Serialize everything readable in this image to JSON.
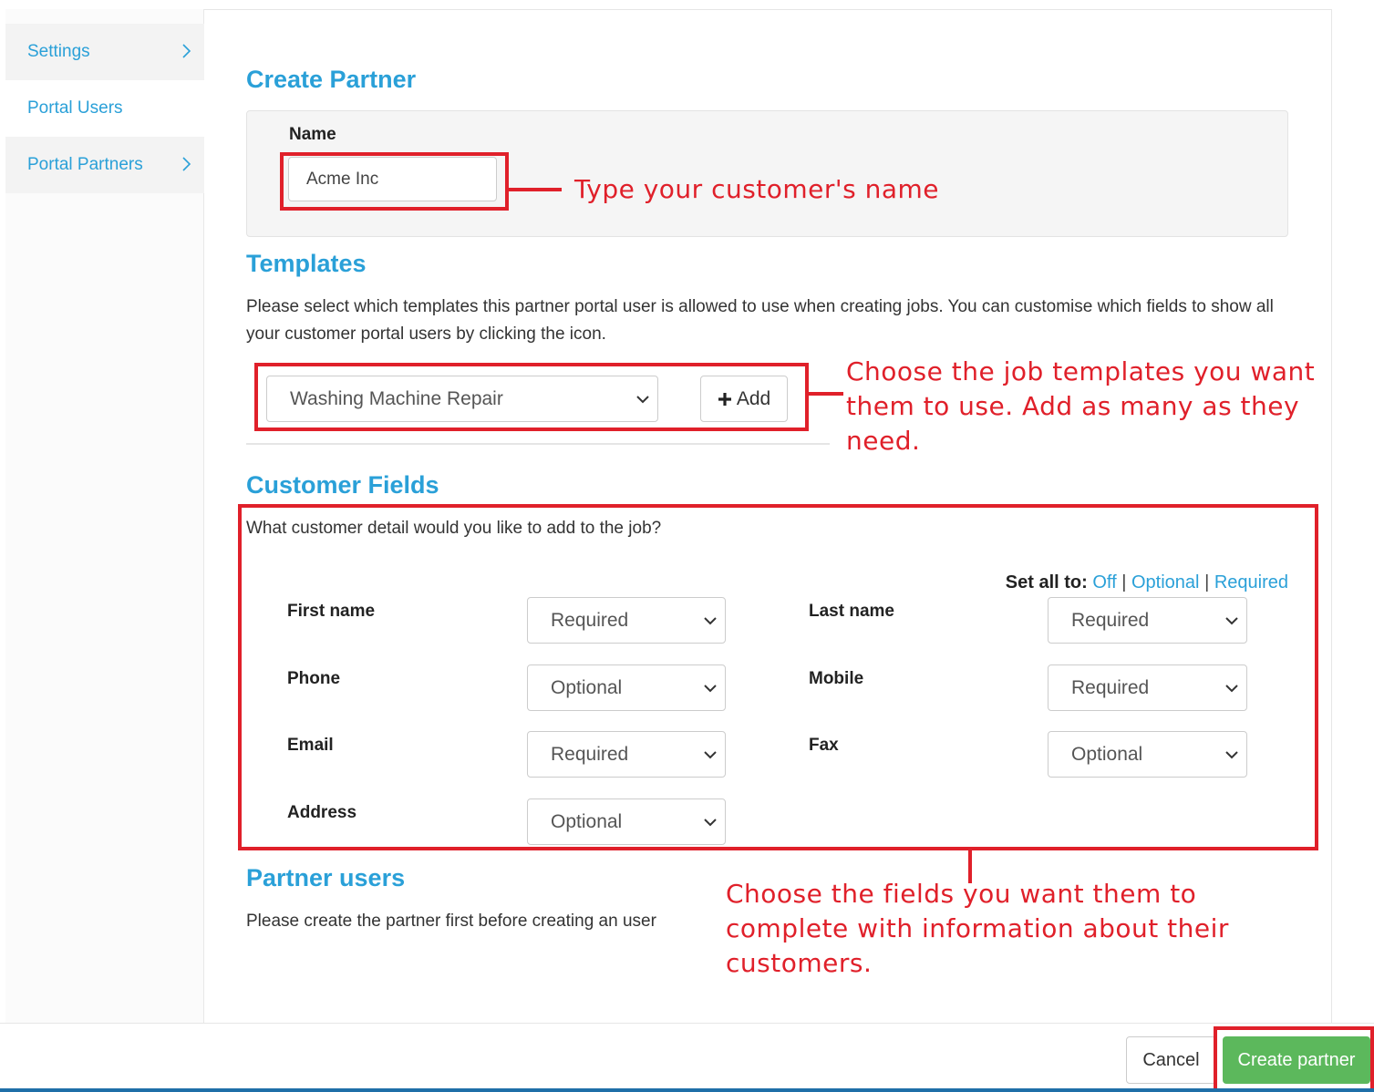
{
  "sidebar": {
    "items": [
      {
        "label": "Settings"
      },
      {
        "label": "Portal Users"
      },
      {
        "label": "Portal Partners"
      }
    ]
  },
  "create_partner": {
    "title": "Create Partner",
    "name_label": "Name",
    "name_value": "Acme Inc"
  },
  "templates": {
    "title": "Templates",
    "description": "Please select which templates this partner portal user is allowed to use when creating jobs. You can customise which fields to show all your customer portal users by clicking the icon.",
    "selected": "Washing Machine Repair",
    "add_label": "Add"
  },
  "customer_fields": {
    "title": "Customer Fields",
    "question": "What customer detail would you like to add to the job?",
    "set_all_label": "Set all to:",
    "set_all_options": [
      "Off",
      "Optional",
      "Required"
    ],
    "fields": [
      {
        "label": "First name",
        "value": "Required"
      },
      {
        "label": "Last name",
        "value": "Required"
      },
      {
        "label": "Phone",
        "value": "Optional"
      },
      {
        "label": "Mobile",
        "value": "Required"
      },
      {
        "label": "Email",
        "value": "Required"
      },
      {
        "label": "Fax",
        "value": "Optional"
      },
      {
        "label": "Address",
        "value": "Optional"
      }
    ]
  },
  "partner_users": {
    "title": "Partner users",
    "note": "Please create the partner first before creating an user"
  },
  "footer": {
    "cancel_label": "Cancel",
    "create_label": "Create partner"
  },
  "annotations": {
    "name_hint": "Type your customer's name",
    "templates_hint_lines": [
      "Choose the job templates you want",
      "them to use. Add as many as they",
      "need."
    ],
    "fields_hint_lines": [
      "Choose the fields you want them to",
      "complete with information about their",
      "customers."
    ]
  },
  "colors": {
    "accent": "#2aa0d8",
    "annotation": "#e0202a",
    "primary_button": "#5cb85c"
  }
}
